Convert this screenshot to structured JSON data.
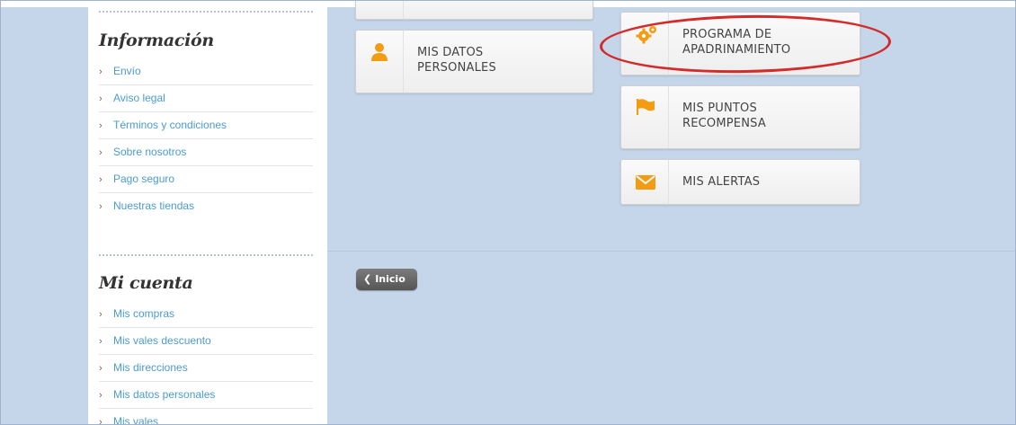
{
  "sidebar": {
    "informacion": {
      "title": "Información",
      "items": [
        "Envío",
        "Aviso legal",
        "Términos y condiciones",
        "Sobre nosotros",
        "Pago seguro",
        "Nuestras tiendas"
      ]
    },
    "mi_cuenta": {
      "title": "Mi cuenta",
      "items": [
        "Mis compras",
        "Mis vales descuento",
        "Mis direcciones",
        "Mis datos personales",
        "Mis vales"
      ]
    },
    "chevron": "›"
  },
  "cards": {
    "datos": {
      "label_line1": "MIS DATOS",
      "label_line2": "PERSONALES",
      "icon": "user-icon",
      "color": "#f39c12"
    },
    "apadrinamiento": {
      "label_line1": "PROGRAMA DE",
      "label_line2": "APADRINAMIENTO",
      "icon": "gears-icon",
      "color": "#f39c12"
    },
    "puntos": {
      "label_line1": "MIS PUNTOS",
      "label_line2": "RECOMPENSA",
      "icon": "flag-icon",
      "color": "#f39c12"
    },
    "alertas": {
      "label": "MIS ALERTAS",
      "icon": "envelope-icon",
      "color": "#f39c12"
    }
  },
  "back_button": {
    "arrow": "❮",
    "label": "Inicio"
  },
  "annotation": {
    "color": "#d42a2a"
  }
}
